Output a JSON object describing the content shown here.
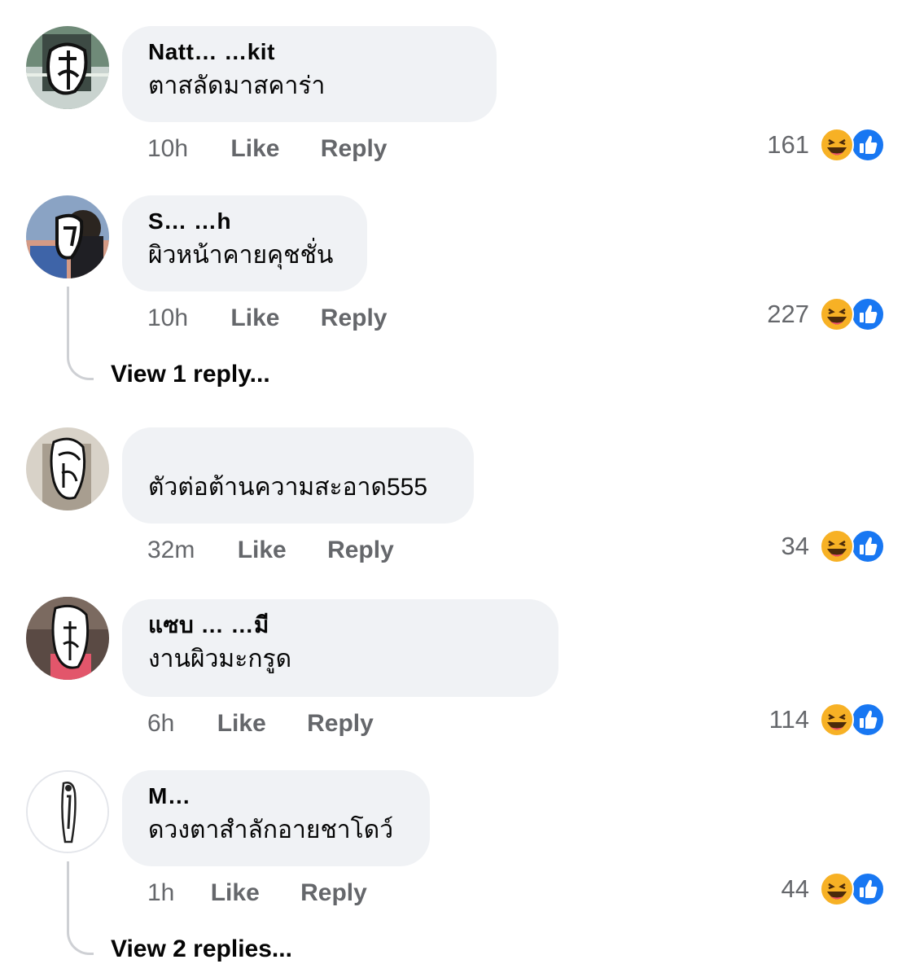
{
  "colors": {
    "bubble": "#f0f2f5",
    "meta": "#65676b",
    "like_blue": "#1877f2",
    "haha_yellow": "#f7b125"
  },
  "comments": [
    {
      "author": "Natt… …kit",
      "text": "ตาสลัดมาสคาร่า",
      "time": "10h",
      "like": "Like",
      "reply": "Reply",
      "reaction_count": "161"
    },
    {
      "author": "S… …h",
      "text": "ผิวหน้าคายคุชชั่น",
      "time": "10h",
      "like": "Like",
      "reply": "Reply",
      "reaction_count": "227",
      "view_replies": "View 1 reply..."
    },
    {
      "author": "",
      "text": "ตัวต่อต้านความสะอาด555",
      "time": "32m",
      "like": "Like",
      "reply": "Reply",
      "reaction_count": "34"
    },
    {
      "author": "แซบ … …มี",
      "text": "งานผิวมะกรูด",
      "time": "6h",
      "like": "Like",
      "reply": "Reply",
      "reaction_count": "114"
    },
    {
      "author": "M…",
      "text": "ดวงตาสำลักอายชาโดว์",
      "time": "1h",
      "like": "Like",
      "reply": "Reply",
      "reaction_count": "44",
      "view_replies": "View 2 replies..."
    }
  ],
  "icons": {
    "reaction_1": "haha-emoji-icon",
    "reaction_2": "like-thumb-icon"
  }
}
